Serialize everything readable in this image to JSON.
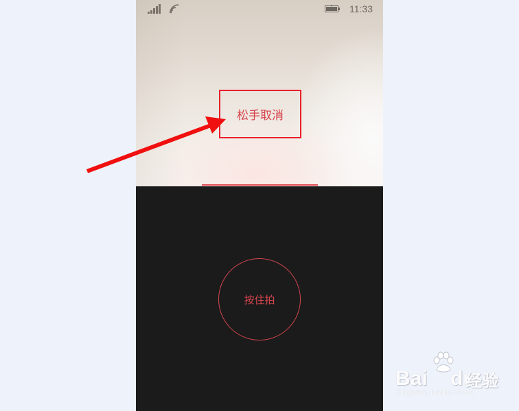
{
  "status_bar": {
    "time": "11:33",
    "icons": [
      "signal-icon",
      "wifi-icon",
      "battery-icon"
    ]
  },
  "viewfinder": {
    "cancel_hint": "松手取消",
    "recording_progress_fraction": 0.47
  },
  "controls": {
    "shutter_label": "按住拍"
  },
  "annotation": {
    "arrow_color": "#f01010",
    "highlight_color": "#e8202a"
  },
  "watermark": {
    "brand_left": "Bai",
    "brand_right": "du",
    "product": "经验",
    "url": "jingyan.baidu.com",
    "icon": "paw-icon"
  },
  "colors": {
    "accent": "#d5454e",
    "camera_panel": "#1b1b1b",
    "page_background": "#eef2fb"
  }
}
